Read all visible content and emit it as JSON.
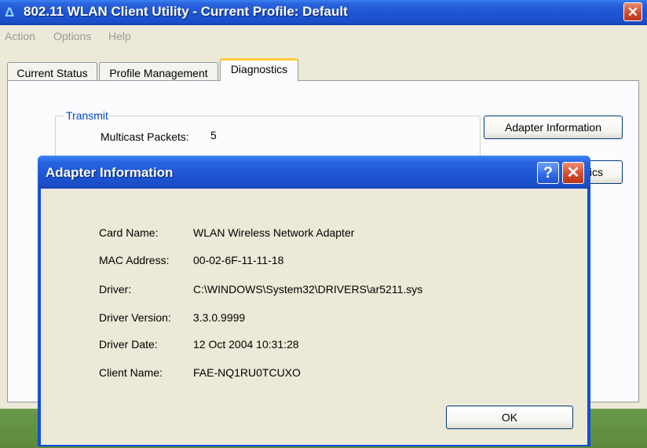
{
  "window": {
    "title": "802.11 WLAN Client Utility - Current Profile: Default",
    "icon": "wireless-a-icon",
    "close_glyph": "✕"
  },
  "menu": {
    "items": [
      "Action",
      "Options",
      "Help"
    ]
  },
  "tabs": [
    {
      "label": "Current Status",
      "active": false
    },
    {
      "label": "Profile Management",
      "active": false
    },
    {
      "label": "Diagnostics",
      "active": true
    }
  ],
  "diagnostics": {
    "group_label": "Transmit",
    "multicast_label": "Multicast Packets:",
    "multicast_value": "5",
    "adapter_info_button": "Adapter Information",
    "partial_button_text": "ics"
  },
  "dialog": {
    "title": "Adapter Information",
    "help_glyph": "?",
    "close_glyph": "✕",
    "fields": [
      {
        "label": "Card Name:",
        "value": "WLAN Wireless Network Adapter"
      },
      {
        "label": "MAC Address:",
        "value": "00-02-6F-11-11-18"
      },
      {
        "label": "Driver:",
        "value": "C:\\WINDOWS\\System32\\DRIVERS\\ar5211.sys"
      },
      {
        "label": "Driver Version:",
        "value": "3.3.0.9999"
      },
      {
        "label": "Driver Date:",
        "value": "12 Oct 2004 10:31:28"
      },
      {
        "label": "Client Name:",
        "value": "FAE-NQ1RU0TCUXO"
      }
    ],
    "ok_label": "OK"
  },
  "colors": {
    "titlebar": "#1f55d2",
    "group_label": "#0046d5",
    "window_bg": "#ece9d8",
    "close_red": "#d1492a",
    "tab_highlight": "#ffc83c"
  }
}
